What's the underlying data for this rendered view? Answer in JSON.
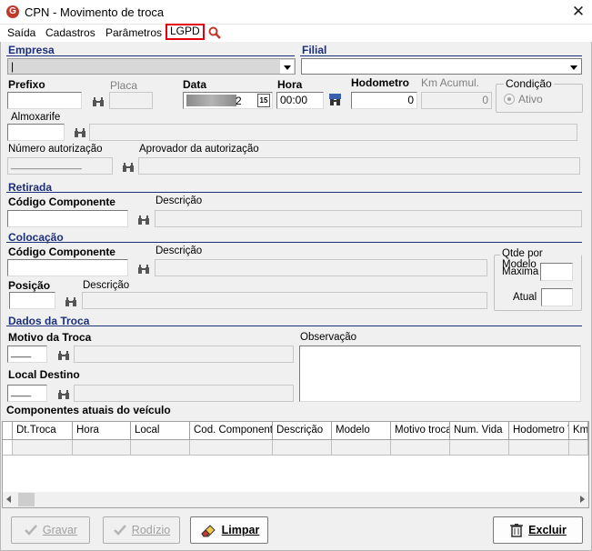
{
  "window": {
    "title": "CPN - Movimento de troca",
    "app_icon": "G"
  },
  "menu": {
    "items": [
      "Saída",
      "Cadastros",
      "Parâmetros",
      "LGPD"
    ],
    "highlight_color": "#e3000f"
  },
  "header": {
    "empresa_label": "Empresa",
    "filial_label": "Filial",
    "empresa_value": "|",
    "filial_value": "",
    "prefixo_label": "Prefixo",
    "placa_label": "Placa",
    "data_label": "Data",
    "data_value": "2",
    "data_calendar": "15",
    "hora_label": "Hora",
    "hora_value": "00:00",
    "hodometro_label": "Hodometro",
    "hodometro_value": "0",
    "km_acumul_label": "Km Acumul.",
    "km_acumul_value": "0",
    "condicao_label": "Condição",
    "condicao_option": "Ativo",
    "almoxarife_label": "Almoxarife",
    "num_autorizacao_label": "Número autorização",
    "num_autorizacao_value": "______________",
    "aprovador_label": "Aprovador da autorização"
  },
  "retirada": {
    "title": "Retirada",
    "codigo_label": "Código Componente",
    "descricao_label": "Descrição"
  },
  "colocacao": {
    "title": "Colocação",
    "codigo_label": "Código Componente",
    "descricao_label": "Descrição",
    "posicao_label": "Posição",
    "posicao_descricao_label": "Descrição",
    "qtde_title": "Qtde por Modelo",
    "maxima_label": "Maxima",
    "atual_label": "Atual"
  },
  "dados_troca": {
    "title": "Dados da Troca",
    "motivo_label": "Motivo da Troca",
    "motivo_value": "____",
    "observacao_label": "Observação",
    "local_destino_label": "Local Destino",
    "local_destino_value": "____"
  },
  "componentes": {
    "title": "Componentes atuais do veículo",
    "columns": [
      "Dt.Troca",
      "Hora",
      "Local",
      "Cod. Componente",
      "Descrição",
      "Modelo",
      "Motivo troca",
      "Num. Vida",
      "Hodometro V",
      "Km"
    ]
  },
  "buttons": {
    "gravar": "Gravar",
    "rodizio": "Rodízio",
    "limpar": "Limpar",
    "excluir": "Excluir"
  }
}
